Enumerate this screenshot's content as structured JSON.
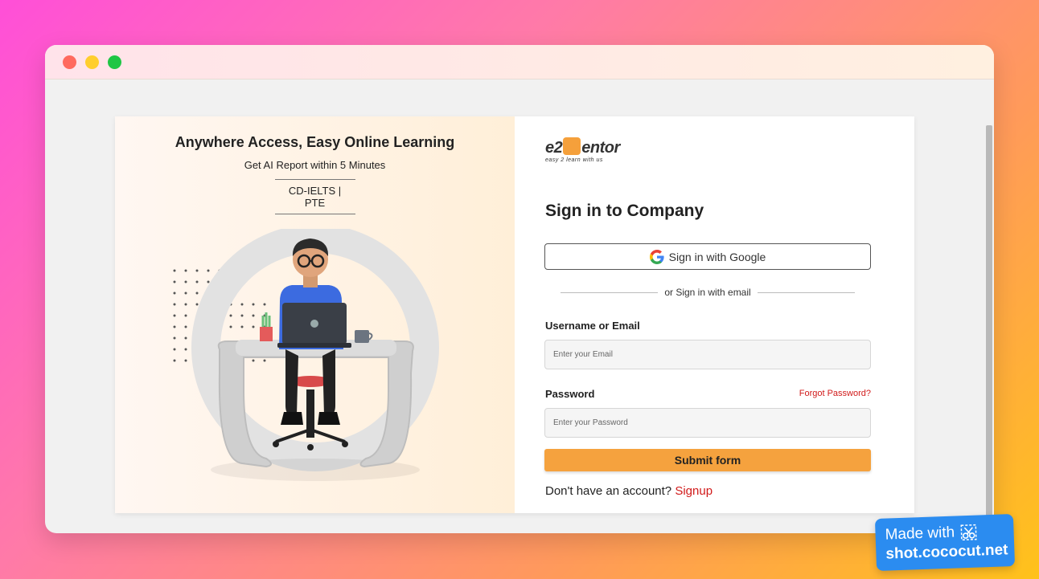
{
  "left_panel": {
    "heading": "Anywhere Access, Easy Online Learning",
    "subheading": "Get AI Report within 5 Minutes",
    "tag": "CD-IELTS | PTE"
  },
  "logo": {
    "text_start": "e2",
    "text_end": "entor",
    "tagline": "easy 2 learn with us"
  },
  "signin": {
    "title": "Sign in to Company",
    "google_label": "Sign in with Google",
    "divider_text": "or Sign in with email",
    "username_label": "Username or Email",
    "email_placeholder": "Enter your Email",
    "password_label": "Password",
    "forgot_label": "Forgot Password?",
    "password_placeholder": "Enter your Password",
    "submit_label": "Submit form",
    "no_account_text": "Don't have an account?",
    "signup_label": "Signup"
  },
  "badge": {
    "line1": "Made with",
    "line2": "shot.cococut.net"
  },
  "colors": {
    "accent": "#f5a23e",
    "link_red": "#d11a1a",
    "badge_blue": "#2b8cf0"
  }
}
